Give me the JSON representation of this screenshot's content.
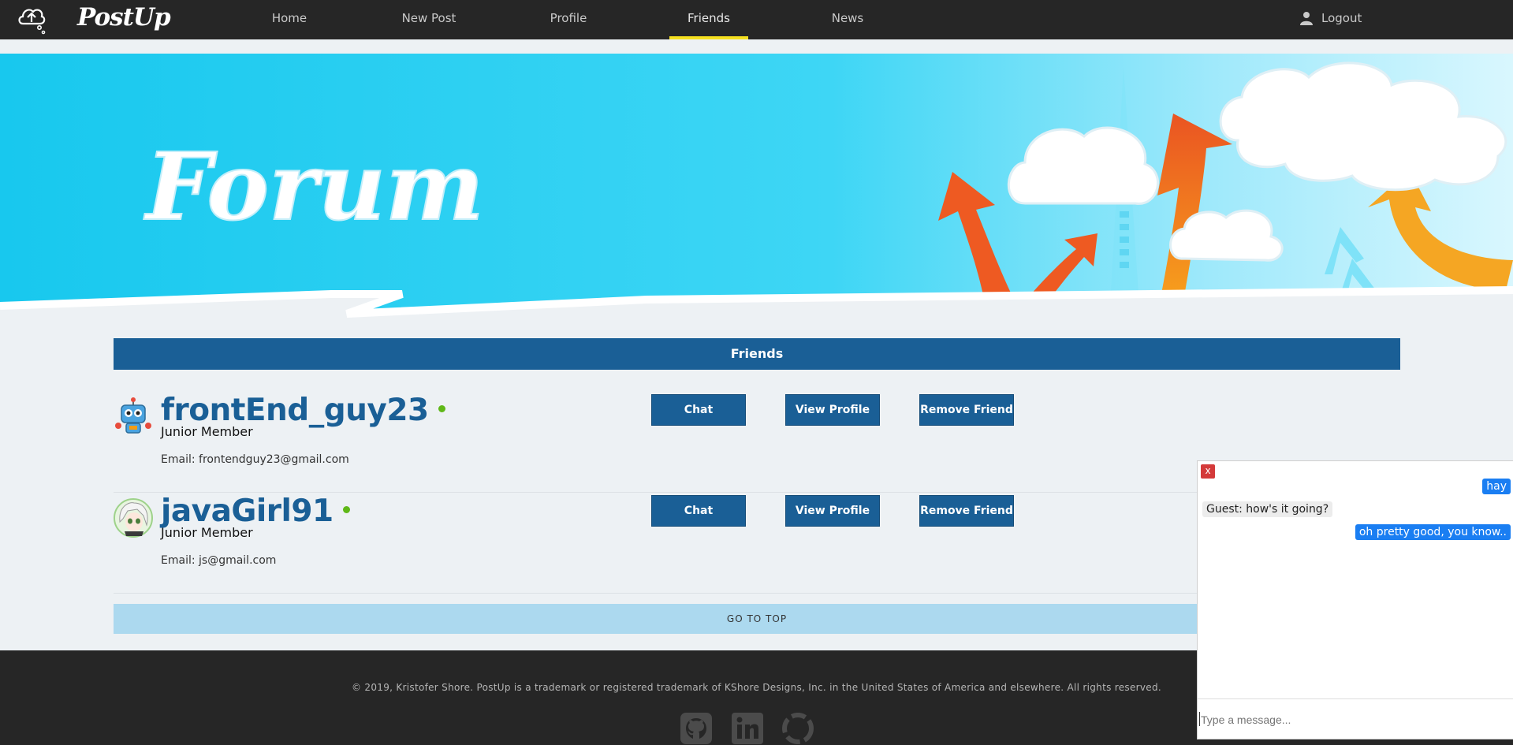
{
  "nav": {
    "logo": "PostUp",
    "items": [
      {
        "label": "Home"
      },
      {
        "label": "New Post"
      },
      {
        "label": "Profile"
      },
      {
        "label": "Friends"
      },
      {
        "label": "News"
      }
    ],
    "active": "Friends",
    "logout": "Logout"
  },
  "hero": {
    "title": "Forum"
  },
  "friends": {
    "header": "Friends",
    "list": [
      {
        "name": "frontEnd_guy23",
        "rank": "Junior Member",
        "email": "Email: frontendguy23@gmail.com",
        "online": true
      },
      {
        "name": "javaGirl91",
        "rank": "Junior Member",
        "email": "Email: js@gmail.com",
        "online": true
      }
    ],
    "buttons": {
      "chat": "Chat",
      "view_profile": "View Profile",
      "remove": "Remove Friend"
    }
  },
  "go_top": "GO TO TOP",
  "footer": {
    "copyright": "© 2019, Kristofer Shore. PostUp is a trademark or registered trademark of KShore Designs, Inc. in the United States of America and elsewhere. All rights reserved.",
    "social_icons": [
      "github-icon",
      "linkedin-icon",
      "portfolio-icon"
    ]
  },
  "chat": {
    "close": "x",
    "messages": [
      {
        "from": "me",
        "text": "hay"
      },
      {
        "from": "guest",
        "text": "Guest: how's it going?"
      },
      {
        "from": "me",
        "text": "oh pretty good, you know.."
      }
    ],
    "placeholder": "Type a message..."
  },
  "colors": {
    "primary": "#1a5f96",
    "nav_bg": "#262626",
    "active_underline": "#f5e020",
    "online": "#5fb817",
    "chat_bubble": "#1a7ef2",
    "go_top_bg": "#acd9ef"
  }
}
